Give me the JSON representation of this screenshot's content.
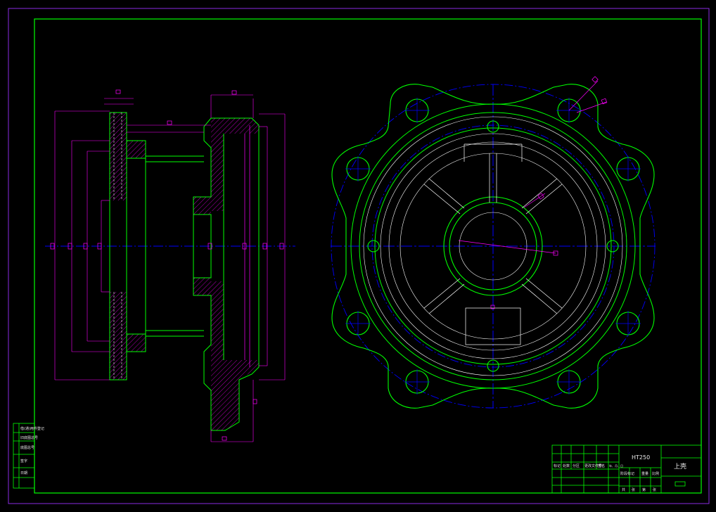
{
  "title_block": {
    "material": "HT250",
    "part_name": "上壳",
    "header_row": [
      "标记",
      "处数",
      "分区",
      "更改文件号",
      "签名",
      "年、月、日"
    ],
    "stage_labels": [
      "阶段标记",
      "重量",
      "比例"
    ],
    "sheet_labels": [
      "共",
      "张",
      "第",
      "张"
    ]
  },
  "left_side_table": {
    "rows": [
      "借(通)用件登记",
      "旧底图总号",
      "底图总号",
      "签字",
      "日期"
    ]
  },
  "colors": {
    "border": "#00ff00",
    "contour": "#00ff00",
    "dimension": "#ff00ff",
    "centerline": "#0000ff",
    "hidden": "#ffffff",
    "background": "#000000"
  }
}
